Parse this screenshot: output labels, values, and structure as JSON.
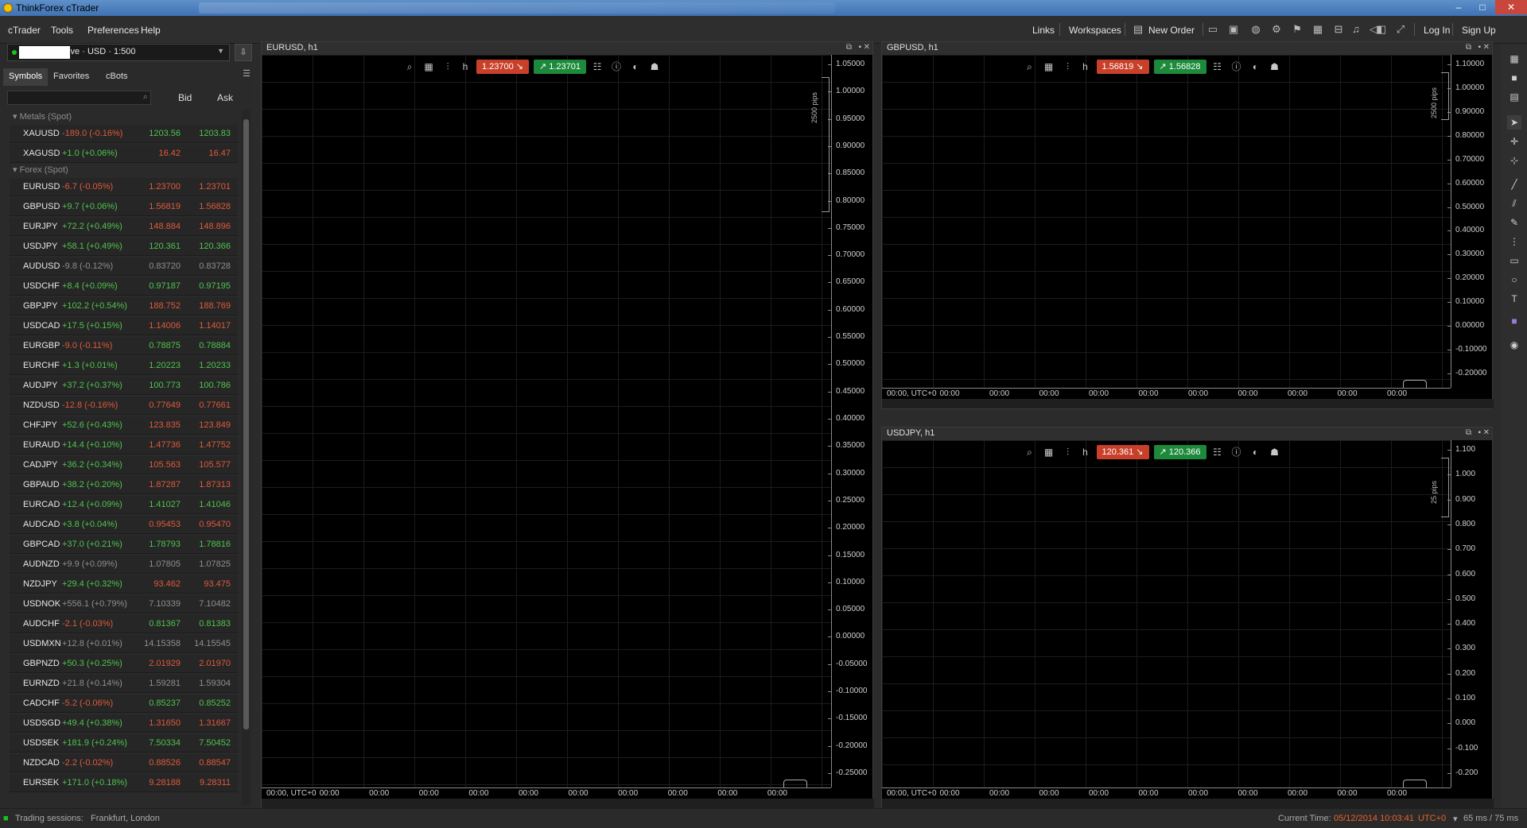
{
  "window": {
    "title": "ThinkForex cTrader",
    "minimize": "–",
    "maximize": "□",
    "close": "✕"
  },
  "menu": [
    "cTrader",
    "Tools",
    "Preferences",
    "Help"
  ],
  "topbar": {
    "links": "Links",
    "workspaces": "Workspaces",
    "new_order": "New Order",
    "login": "Log In",
    "signup": "Sign Up"
  },
  "account": {
    "label": "Live · USD · 1:500",
    "status_color": "#19c419"
  },
  "tabs": [
    "Symbols",
    "Favorites",
    "cBots"
  ],
  "columns": {
    "bid": "Bid",
    "ask": "Ask"
  },
  "groups": [
    {
      "name": "Metals (Spot)",
      "symbols": [
        {
          "n": "XAUUSD",
          "c": "-189.0 (-0.16%)",
          "d": "neg",
          "bid": "1203.56",
          "bc": "pos",
          "ask": "1203.83",
          "ac": "pos"
        },
        {
          "n": "XAGUSD",
          "c": "+1.0 (+0.06%)",
          "d": "pos",
          "bid": "16.42",
          "bc": "neg",
          "ask": "16.47",
          "ac": "neg"
        }
      ]
    },
    {
      "name": "Forex (Spot)",
      "symbols": [
        {
          "n": "EURUSD",
          "c": "-6.7 (-0.05%)",
          "d": "neg",
          "bid": "1.23700",
          "bc": "neg",
          "ask": "1.23701",
          "ac": "neg"
        },
        {
          "n": "GBPUSD",
          "c": "+9.7 (+0.06%)",
          "d": "pos",
          "bid": "1.56819",
          "bc": "neg",
          "ask": "1.56828",
          "ac": "neg"
        },
        {
          "n": "EURJPY",
          "c": "+72.2 (+0.49%)",
          "d": "pos",
          "bid": "148.884",
          "bc": "neg",
          "ask": "148.896",
          "ac": "neg"
        },
        {
          "n": "USDJPY",
          "c": "+58.1 (+0.49%)",
          "d": "pos",
          "bid": "120.361",
          "bc": "pos",
          "ask": "120.366",
          "ac": "pos"
        },
        {
          "n": "AUDUSD",
          "c": "-9.8 (-0.12%)",
          "d": "neu",
          "bid": "0.83720",
          "bc": "neu",
          "ask": "0.83728",
          "ac": "neu"
        },
        {
          "n": "USDCHF",
          "c": "+8.4 (+0.09%)",
          "d": "pos",
          "bid": "0.97187",
          "bc": "pos",
          "ask": "0.97195",
          "ac": "pos"
        },
        {
          "n": "GBPJPY",
          "c": "+102.2 (+0.54%)",
          "d": "pos",
          "bid": "188.752",
          "bc": "neg",
          "ask": "188.769",
          "ac": "neg"
        },
        {
          "n": "USDCAD",
          "c": "+17.5 (+0.15%)",
          "d": "pos",
          "bid": "1.14006",
          "bc": "neg",
          "ask": "1.14017",
          "ac": "neg"
        },
        {
          "n": "EURGBP",
          "c": "-9.0 (-0.11%)",
          "d": "neg",
          "bid": "0.78875",
          "bc": "pos",
          "ask": "0.78884",
          "ac": "pos"
        },
        {
          "n": "EURCHF",
          "c": "+1.3 (+0.01%)",
          "d": "pos",
          "bid": "1.20223",
          "bc": "pos",
          "ask": "1.20233",
          "ac": "pos"
        },
        {
          "n": "AUDJPY",
          "c": "+37.2 (+0.37%)",
          "d": "pos",
          "bid": "100.773",
          "bc": "pos",
          "ask": "100.786",
          "ac": "pos"
        },
        {
          "n": "NZDUSD",
          "c": "-12.8 (-0.16%)",
          "d": "neg",
          "bid": "0.77649",
          "bc": "neg",
          "ask": "0.77661",
          "ac": "neg"
        },
        {
          "n": "CHFJPY",
          "c": "+52.6 (+0.43%)",
          "d": "pos",
          "bid": "123.835",
          "bc": "neg",
          "ask": "123.849",
          "ac": "neg"
        },
        {
          "n": "EURAUD",
          "c": "+14.4 (+0.10%)",
          "d": "pos",
          "bid": "1.47736",
          "bc": "neg",
          "ask": "1.47752",
          "ac": "neg"
        },
        {
          "n": "CADJPY",
          "c": "+36.2 (+0.34%)",
          "d": "pos",
          "bid": "105.563",
          "bc": "neg",
          "ask": "105.577",
          "ac": "neg"
        },
        {
          "n": "GBPAUD",
          "c": "+38.2 (+0.20%)",
          "d": "pos",
          "bid": "1.87287",
          "bc": "neg",
          "ask": "1.87313",
          "ac": "neg"
        },
        {
          "n": "EURCAD",
          "c": "+12.4 (+0.09%)",
          "d": "pos",
          "bid": "1.41027",
          "bc": "pos",
          "ask": "1.41046",
          "ac": "pos"
        },
        {
          "n": "AUDCAD",
          "c": "+3.8 (+0.04%)",
          "d": "pos",
          "bid": "0.95453",
          "bc": "neg",
          "ask": "0.95470",
          "ac": "neg"
        },
        {
          "n": "GBPCAD",
          "c": "+37.0 (+0.21%)",
          "d": "pos",
          "bid": "1.78793",
          "bc": "pos",
          "ask": "1.78816",
          "ac": "pos"
        },
        {
          "n": "AUDNZD",
          "c": "+9.9 (+0.09%)",
          "d": "neu",
          "bid": "1.07805",
          "bc": "neu",
          "ask": "1.07825",
          "ac": "neu"
        },
        {
          "n": "NZDJPY",
          "c": "+29.4 (+0.32%)",
          "d": "pos",
          "bid": "93.462",
          "bc": "neg",
          "ask": "93.475",
          "ac": "neg"
        },
        {
          "n": "USDNOK",
          "c": "+556.1 (+0.79%)",
          "d": "neu",
          "bid": "7.10339",
          "bc": "neu",
          "ask": "7.10482",
          "ac": "neu"
        },
        {
          "n": "AUDCHF",
          "c": "-2.1 (-0.03%)",
          "d": "neg",
          "bid": "0.81367",
          "bc": "pos",
          "ask": "0.81383",
          "ac": "pos"
        },
        {
          "n": "USDMXN",
          "c": "+12.8 (+0.01%)",
          "d": "neu",
          "bid": "14.15358",
          "bc": "neu",
          "ask": "14.15545",
          "ac": "neu"
        },
        {
          "n": "GBPNZD",
          "c": "+50.3 (+0.25%)",
          "d": "pos",
          "bid": "2.01929",
          "bc": "neg",
          "ask": "2.01970",
          "ac": "neg"
        },
        {
          "n": "EURNZD",
          "c": "+21.8 (+0.14%)",
          "d": "neu",
          "bid": "1.59281",
          "bc": "neu",
          "ask": "1.59304",
          "ac": "neu"
        },
        {
          "n": "CADCHF",
          "c": "-5.2 (-0.06%)",
          "d": "neg",
          "bid": "0.85237",
          "bc": "pos",
          "ask": "0.85252",
          "ac": "pos"
        },
        {
          "n": "USDSGD",
          "c": "+49.4 (+0.38%)",
          "d": "pos",
          "bid": "1.31650",
          "bc": "neg",
          "ask": "1.31667",
          "ac": "neg"
        },
        {
          "n": "USDSEK",
          "c": "+181.9 (+0.24%)",
          "d": "pos",
          "bid": "7.50334",
          "bc": "pos",
          "ask": "7.50452",
          "ac": "pos"
        },
        {
          "n": "NZDCAD",
          "c": "-2.2 (-0.02%)",
          "d": "neg",
          "bid": "0.88526",
          "bc": "neg",
          "ask": "0.88547",
          "ac": "neg"
        },
        {
          "n": "EURSEK",
          "c": "+171.0 (+0.18%)",
          "d": "pos",
          "bid": "9.28188",
          "bc": "neg",
          "ask": "9.28311",
          "ac": "neg"
        }
      ]
    }
  ],
  "charts": [
    {
      "title": "EURUSD, h1",
      "sell": "1.23700",
      "buy": "1.23701",
      "period": "h",
      "pips": "2500 pips",
      "yticks": [
        "1.05000",
        "1.00000",
        "0.95000",
        "0.90000",
        "0.85000",
        "0.80000",
        "0.75000",
        "0.70000",
        "0.65000",
        "0.60000",
        "0.55000",
        "0.50000",
        "0.45000",
        "0.40000",
        "0.35000",
        "0.30000",
        "0.25000",
        "0.20000",
        "0.15000",
        "0.10000",
        "0.05000",
        "0.00000",
        "-0.05000",
        "-0.10000",
        "-0.15000",
        "-0.20000",
        "-0.25000"
      ],
      "xticks": [
        "00:00, UTC+0",
        "00:00",
        "00:00",
        "00:00",
        "00:00",
        "00:00",
        "00:00",
        "00:00",
        "00:00",
        "00:00",
        "00:00"
      ]
    },
    {
      "title": "GBPUSD, h1",
      "sell": "1.56819",
      "buy": "1.56828",
      "period": "h",
      "pips": "2500 pips",
      "yticks": [
        "1.10000",
        "1.00000",
        "0.90000",
        "0.80000",
        "0.70000",
        "0.60000",
        "0.50000",
        "0.40000",
        "0.30000",
        "0.20000",
        "0.10000",
        "0.00000",
        "-0.10000",
        "-0.20000"
      ],
      "xticks": [
        "00:00, UTC+0",
        "00:00",
        "00:00",
        "00:00",
        "00:00",
        "00:00",
        "00:00",
        "00:00",
        "00:00",
        "00:00",
        "00:00"
      ]
    },
    {
      "title": "USDJPY, h1",
      "sell": "120.361",
      "buy": "120.366",
      "period": "h",
      "pips": "25 pips",
      "yticks": [
        "1.100",
        "1.000",
        "0.900",
        "0.800",
        "0.700",
        "0.600",
        "0.500",
        "0.400",
        "0.300",
        "0.200",
        "0.100",
        "0.000",
        "-0.100",
        "-0.200"
      ],
      "xticks": [
        "00:00, UTC+0",
        "00:00",
        "00:00",
        "00:00",
        "00:00",
        "00:00",
        "00:00",
        "00:00",
        "00:00",
        "00:00",
        "00:00"
      ]
    }
  ],
  "status": {
    "sessions_label": "Trading sessions:",
    "sessions": "Frankfurt, London",
    "time_label": "Current Time:",
    "time": "05/12/2014 10:03:41",
    "tz": "UTC+0",
    "latency": "65 ms / 75 ms"
  },
  "colors": {
    "sell": "#c8402a",
    "buy": "#1c8a3a",
    "positive": "#4ec44e",
    "negative": "#e05a3a",
    "accent_time": "#e8622a"
  }
}
